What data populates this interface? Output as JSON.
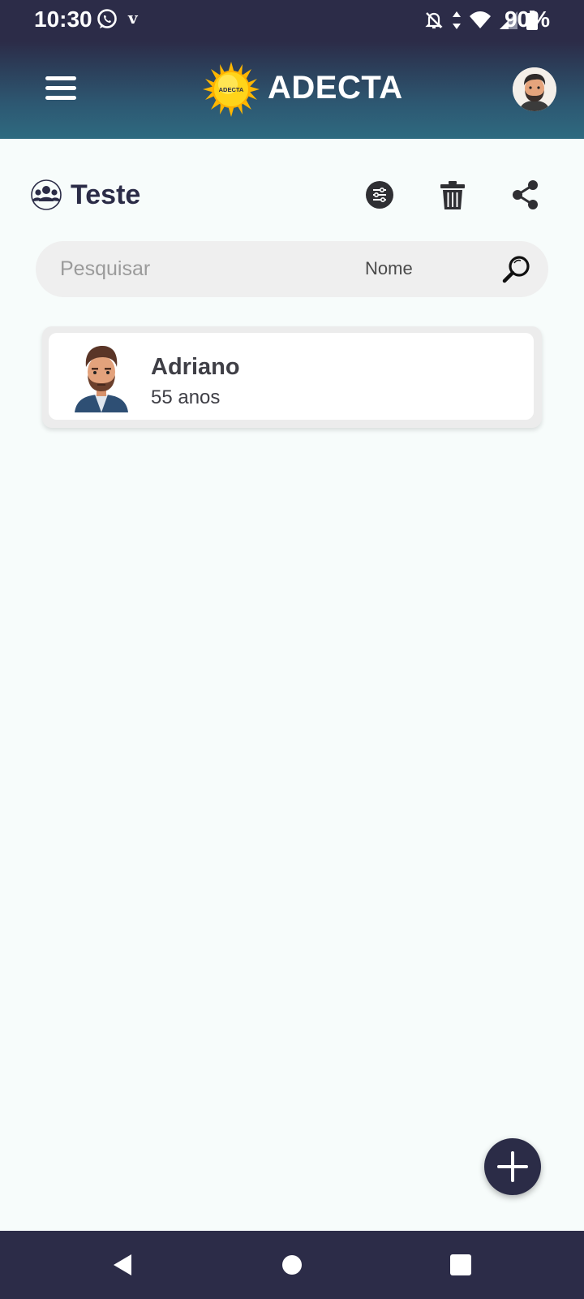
{
  "status_bar": {
    "time": "10:30",
    "carrier_glyph": "v",
    "battery": "90%",
    "icons": [
      "whatsapp-icon",
      "bell-off-icon",
      "data-arrows-icon",
      "wifi-icon",
      "signal-icon",
      "battery-icon"
    ]
  },
  "header": {
    "title": "ADECTA",
    "logo_text": "ADECTA",
    "icons": [
      "menu-icon",
      "profile-avatar"
    ]
  },
  "group": {
    "title": "Teste",
    "icon": "group-icon",
    "actions": [
      "filter-icon",
      "trash-icon",
      "share-icon"
    ]
  },
  "search": {
    "placeholder": "Pesquisar",
    "value": "",
    "field": "Nome"
  },
  "people": [
    {
      "name": "Adriano",
      "age": "55 anos"
    }
  ],
  "fab": {
    "icon": "plus-icon"
  },
  "navbar": {
    "icons": [
      "back-icon",
      "home-icon",
      "recents-icon"
    ]
  },
  "colors": {
    "primary_dark": "#2b2c47",
    "header_gradient_end": "#2e6a80",
    "background": "#f7fcfb",
    "search_bg": "#efefef",
    "sun_yellow": "#ffd41a"
  }
}
